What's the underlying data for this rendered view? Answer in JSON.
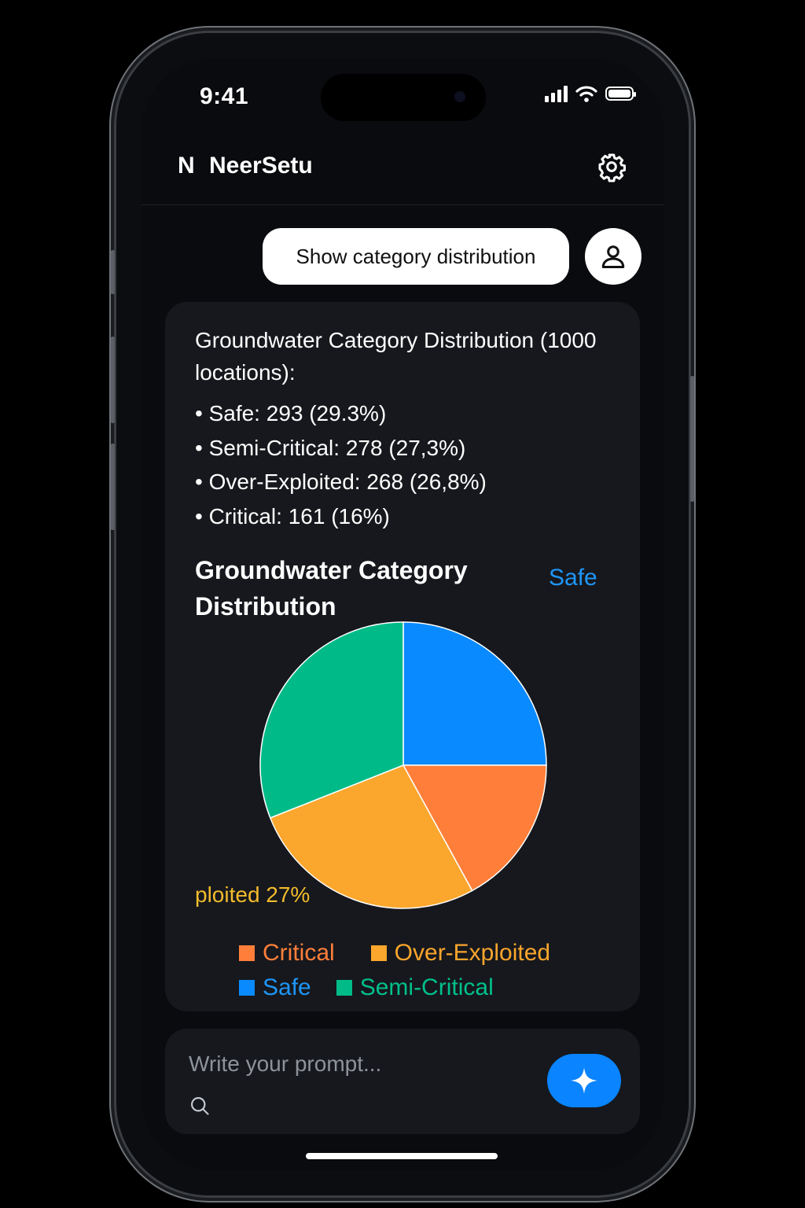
{
  "status_bar": {
    "time": "9:41"
  },
  "header": {
    "logo_letter": "N",
    "app_name": "NeerSetu",
    "settings_icon": "gear-icon"
  },
  "chat": {
    "user_message": "Show category distribution",
    "user_avatar_icon": "person-icon",
    "assistant": {
      "summary_title": "Groundwater Category Distribution (1000 locations):",
      "stats": [
        "• Safe: 293 (29.3%)",
        "• Semi-Critical: 278 (27,3%)",
        "• Over-Exploited: 268 (26,8%)",
        "• Critical: 161 (16%)"
      ],
      "chart_callouts": {
        "safe": "Safe",
        "over_exploited": "ploited 27%"
      }
    }
  },
  "chart_data": {
    "type": "pie",
    "title": "Groundwater Category Distribution",
    "slices": [
      {
        "label": "Safe",
        "value": 25,
        "color": "#0a8aff"
      },
      {
        "label": "Critical",
        "value": 17,
        "color": "#ff7f3a"
      },
      {
        "label": "Over-Exploited",
        "value": 27,
        "color": "#fba62c"
      },
      {
        "label": "Semi-Critical",
        "value": 31,
        "color": "#00bb88"
      }
    ],
    "legend": [
      {
        "label": "Critical",
        "color": "#ff7f3a"
      },
      {
        "label": "Over-Exploited",
        "color": "#fba62c"
      },
      {
        "label": "Safe",
        "color": "#0a8aff"
      },
      {
        "label": "Semi-Critical",
        "color": "#00bb88"
      }
    ],
    "legend_placement": "bottom"
  },
  "prompt": {
    "placeholder": "Write your prompt...",
    "search_icon": "search-icon",
    "send_icon": "sparkle-icon"
  },
  "colors": {
    "accent": "#0a84ff",
    "background": "#0a0b0e",
    "card": "#16181d"
  }
}
